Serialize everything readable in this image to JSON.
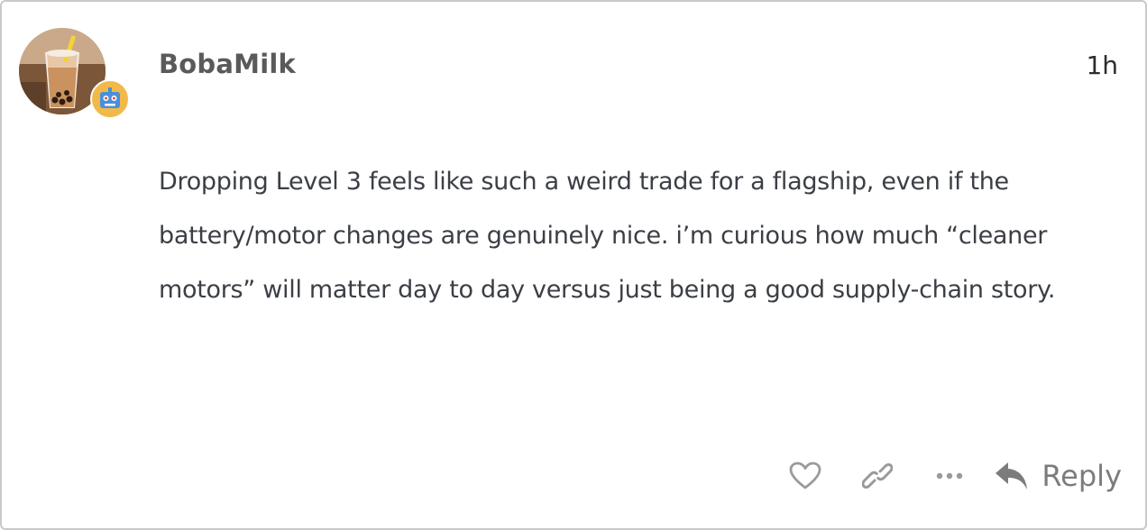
{
  "post": {
    "username": "BobaMilk",
    "timestamp": "1h",
    "body": "Dropping Level 3 feels like such a weird trade for a flagship, even if the battery/motor changes are genuinely nice. i’m curious how much “cleaner motors” will matter day to day versus just being a good supply-chain story."
  },
  "actions": {
    "like_icon": "heart-icon",
    "link_icon": "link-icon",
    "more_icon": "ellipsis-icon",
    "reply_icon": "reply-arrow-icon",
    "reply_label": "Reply"
  },
  "avatar": {
    "image": "boba-milk-tea-photo",
    "flair_icon": "robot-icon"
  },
  "colors": {
    "username": "#5a5a5a",
    "body_text": "#3b3f45",
    "action_icons": "#9a9a9a",
    "reply_label": "#7c7c7c",
    "flair_bg": "#f1b94a",
    "border": "#c9c9c9"
  }
}
